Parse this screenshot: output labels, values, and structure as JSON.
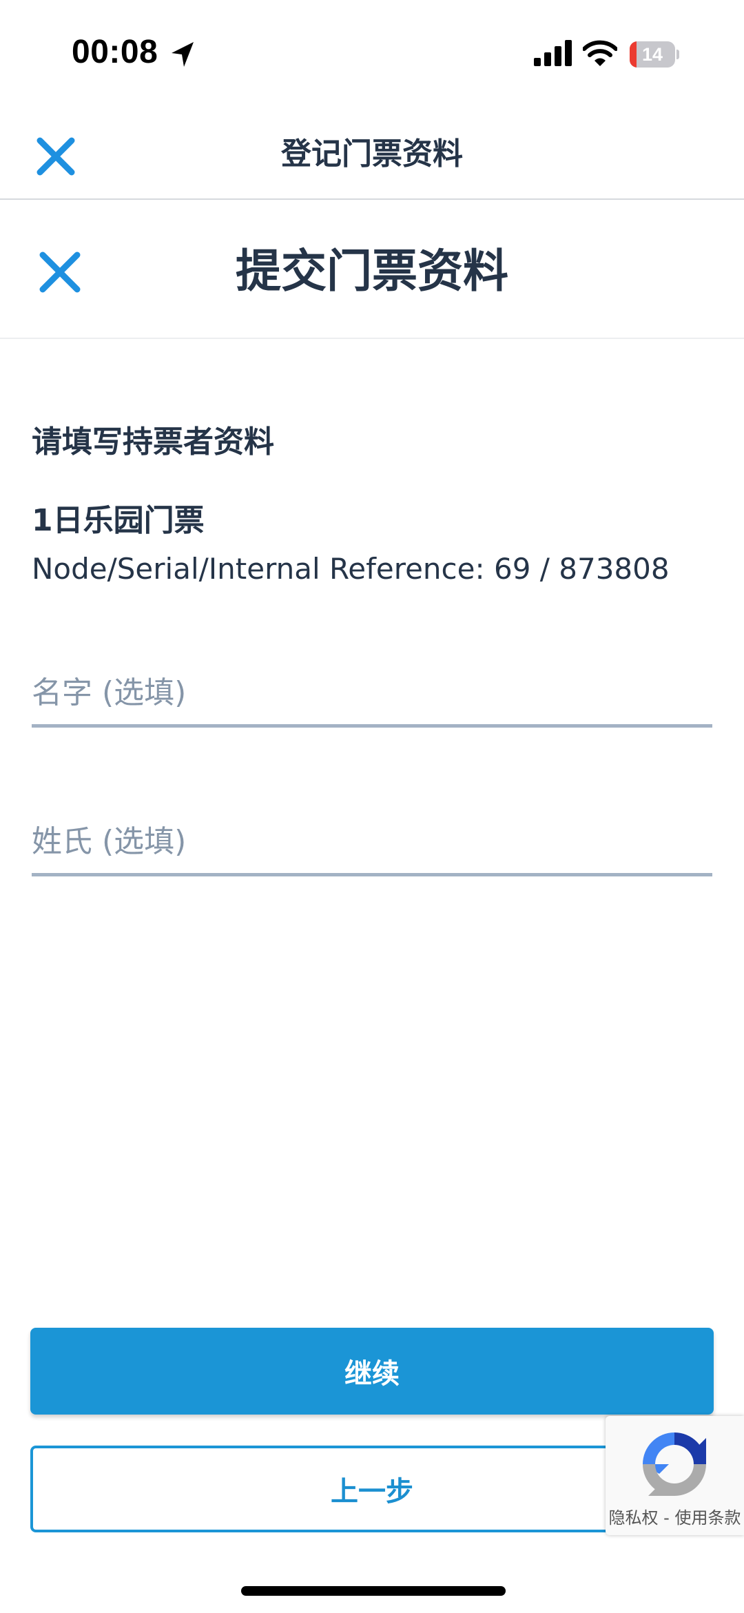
{
  "status_bar": {
    "time": "00:08",
    "battery_level": "14",
    "icons": [
      "location-arrow-icon",
      "cellular-signal-icon",
      "wifi-icon",
      "battery-icon"
    ]
  },
  "navbar": {
    "title": "登记门票资料",
    "close_icon": "close-icon"
  },
  "page": {
    "title": "提交门票资料",
    "close_icon": "close-icon"
  },
  "form": {
    "section_title": "请填写持票者资料",
    "ticket_name": "1日乐园门票",
    "ticket_reference": "Node/Serial/Internal Reference: 69 / 873808",
    "first_name_placeholder": "名字 (选填)",
    "first_name_value": "",
    "last_name_placeholder": "姓氏 (选填)",
    "last_name_value": ""
  },
  "buttons": {
    "continue_label": "继续",
    "back_label": "上一步"
  },
  "recaptcha": {
    "privacy_label": "隐私权",
    "separator": " - ",
    "terms_label": "使用条款"
  },
  "colors": {
    "accent": "#1b95d6",
    "close_icon": "#1e90e0",
    "text": "#253448",
    "field_underline": "#a3b2c4",
    "placeholder": "#8595a8"
  }
}
